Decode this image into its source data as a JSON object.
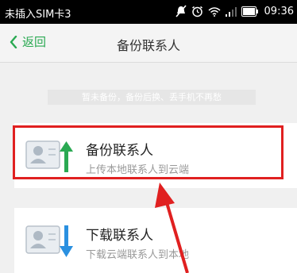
{
  "status_bar": {
    "carrier": "未插入SIM卡3",
    "time": "09:36",
    "icons": [
      "mute-icon",
      "alarm-icon",
      "wifi-icon",
      "signal-icon",
      "battery-icon"
    ]
  },
  "header": {
    "back_label": "返回",
    "title": "备份联系人"
  },
  "notice": {
    "text": "暂未备份，备份后换、丢手机不再愁"
  },
  "cards": {
    "backup": {
      "title": "备份联系人",
      "subtitle": "上传本地联系人到云端",
      "icon": "contact-upload-icon"
    },
    "download": {
      "title": "下载联系人",
      "subtitle": "下载云端联系人到本地",
      "icon": "contact-download-icon"
    }
  },
  "colors": {
    "accent": "#2aa952",
    "download_arrow": "#2a90e0",
    "highlight": "#e02020",
    "background": "#f0f0f0"
  }
}
